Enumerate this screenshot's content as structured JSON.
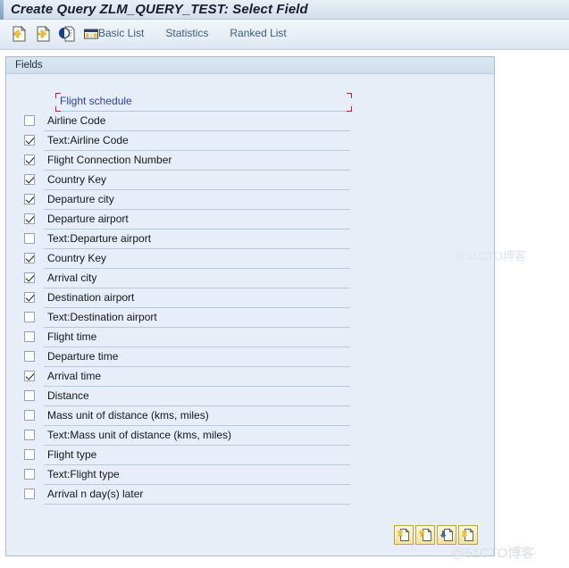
{
  "window": {
    "title": "Create Query ZLM_QUERY_TEST: Select Field"
  },
  "toolbar": {
    "icons": [
      {
        "name": "previous-page-icon",
        "glyph": "doc-left-arrow"
      },
      {
        "name": "next-page-icon",
        "glyph": "doc-right-arrow"
      },
      {
        "name": "document-contrast-icon",
        "glyph": "doc-contrast"
      },
      {
        "name": "layout-table-icon",
        "glyph": "table"
      }
    ],
    "links": [
      {
        "label": "Basic List"
      },
      {
        "label": "Statistics"
      },
      {
        "label": "Ranked List"
      }
    ]
  },
  "panel": {
    "tab_label": "Fields",
    "group": {
      "label": "Flight schedule",
      "focus_color": "#b02a2a",
      "text_color": "#2c3fa8"
    },
    "fields": [
      {
        "label": "Airline Code",
        "checked": false
      },
      {
        "label": "Text:Airline Code",
        "checked": true
      },
      {
        "label": "Flight Connection Number",
        "checked": true
      },
      {
        "label": "Country Key",
        "checked": true
      },
      {
        "label": "Departure city",
        "checked": true
      },
      {
        "label": "Departure airport",
        "checked": true
      },
      {
        "label": "Text:Departure airport",
        "checked": false
      },
      {
        "label": "Country Key",
        "checked": true
      },
      {
        "label": "Arrival city",
        "checked": true
      },
      {
        "label": "Destination airport",
        "checked": true
      },
      {
        "label": "Text:Destination airport",
        "checked": false
      },
      {
        "label": "Flight time",
        "checked": false
      },
      {
        "label": "Departure time",
        "checked": false
      },
      {
        "label": "Arrival time",
        "checked": true
      },
      {
        "label": "Distance",
        "checked": false
      },
      {
        "label": "Mass unit of distance (kms, miles)",
        "checked": false
      },
      {
        "label": "Text:Mass unit of distance (kms, miles)",
        "checked": false
      },
      {
        "label": "Flight type",
        "checked": false
      },
      {
        "label": "Text:Flight type",
        "checked": false
      },
      {
        "label": "Arrival n day(s) later",
        "checked": false
      }
    ]
  },
  "nav_buttons": [
    {
      "name": "first-page-button",
      "glyph": "first"
    },
    {
      "name": "previous-page-button",
      "glyph": "prev"
    },
    {
      "name": "next-page-button",
      "glyph": "next"
    },
    {
      "name": "last-page-button",
      "glyph": "last"
    }
  ],
  "watermark": {
    "text": "@51CTO博客"
  }
}
